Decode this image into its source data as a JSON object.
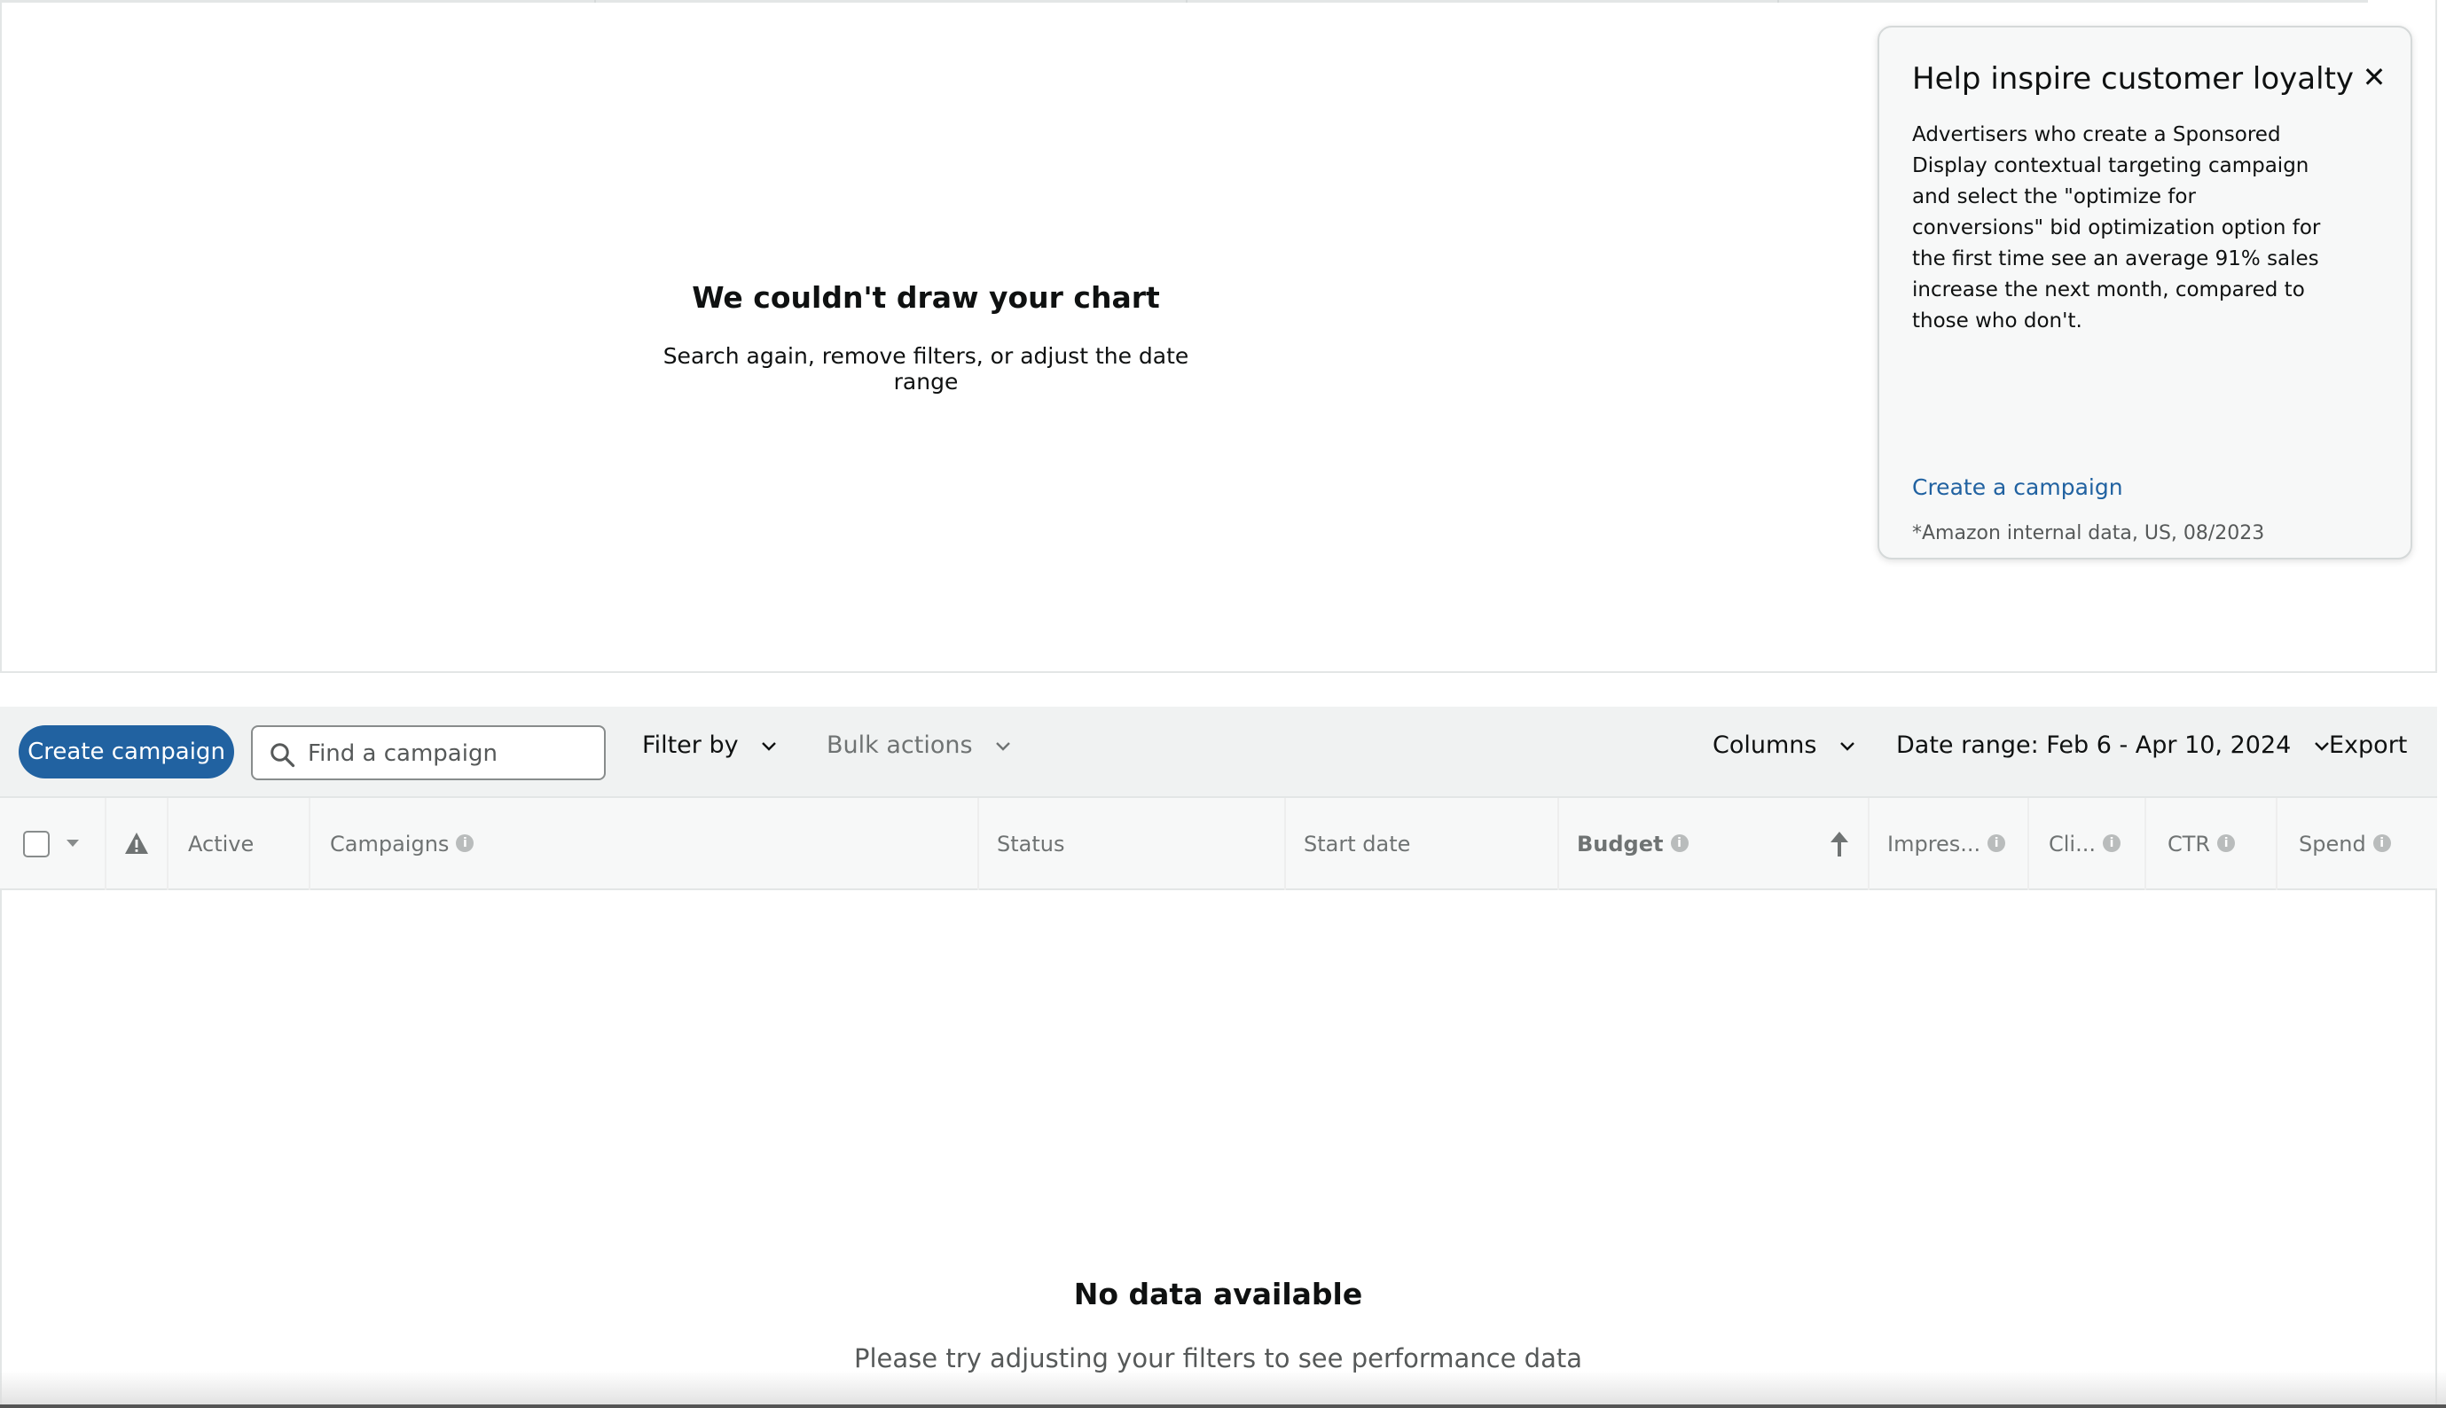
{
  "chart": {
    "empty_title": "We couldn't draw your chart",
    "empty_subtitle": "Search again, remove filters, or adjust the date range"
  },
  "promo": {
    "heading": "Help inspire customer loyalty",
    "close_glyph": "✕",
    "body": "Advertisers who create a Sponsored Display contextual targeting campaign and select the \"optimize for conversions\" bid optimization option for the first time see an average 91% sales increase the next month, compared to those who don't.",
    "link": "Create a campaign",
    "footnote": "*Amazon internal data, US, 08/2023"
  },
  "toolbar": {
    "create_button": "Create campaign",
    "search_placeholder": "Find a campaign",
    "filter_by": "Filter by",
    "bulk_actions": "Bulk actions",
    "columns": "Columns",
    "date_range": "Date range: Feb 6 - Apr 10, 2024",
    "export": "Export"
  },
  "table": {
    "columns": {
      "active": "Active",
      "campaigns": "Campaigns",
      "status": "Status",
      "start_date": "Start date",
      "budget": "Budget",
      "impressions": "Impres...",
      "clicks": "Cli...",
      "ctr": "CTR",
      "spend": "Spend"
    },
    "empty_title": "No data available",
    "empty_subtitle": "Please try adjusting your filters to see performance data"
  },
  "colors": {
    "primary": "#2162a1",
    "link": "#2162a1"
  }
}
